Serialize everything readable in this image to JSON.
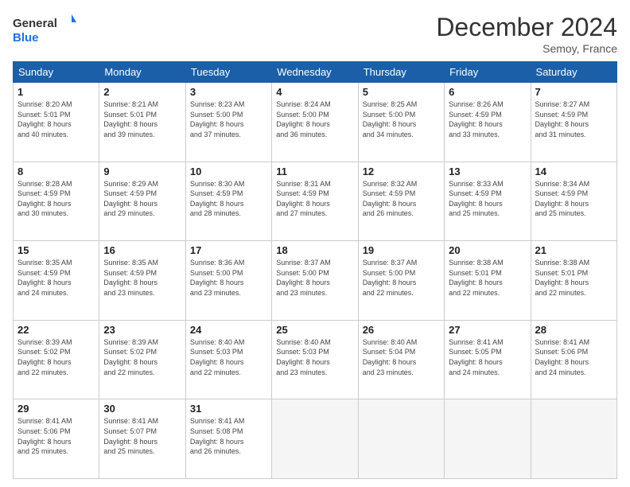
{
  "header": {
    "logo_line1": "General",
    "logo_line2": "Blue",
    "month_title": "December 2024",
    "location": "Semoy, France"
  },
  "days_of_week": [
    "Sunday",
    "Monday",
    "Tuesday",
    "Wednesday",
    "Thursday",
    "Friday",
    "Saturday"
  ],
  "weeks": [
    [
      {
        "day": 1,
        "sunrise": "8:20 AM",
        "sunset": "5:01 PM",
        "daylight": "8 hours and 40 minutes."
      },
      {
        "day": 2,
        "sunrise": "8:21 AM",
        "sunset": "5:01 PM",
        "daylight": "8 hours and 39 minutes."
      },
      {
        "day": 3,
        "sunrise": "8:23 AM",
        "sunset": "5:00 PM",
        "daylight": "8 hours and 37 minutes."
      },
      {
        "day": 4,
        "sunrise": "8:24 AM",
        "sunset": "5:00 PM",
        "daylight": "8 hours and 36 minutes."
      },
      {
        "day": 5,
        "sunrise": "8:25 AM",
        "sunset": "5:00 PM",
        "daylight": "8 hours and 34 minutes."
      },
      {
        "day": 6,
        "sunrise": "8:26 AM",
        "sunset": "4:59 PM",
        "daylight": "8 hours and 33 minutes."
      },
      {
        "day": 7,
        "sunrise": "8:27 AM",
        "sunset": "4:59 PM",
        "daylight": "8 hours and 31 minutes."
      }
    ],
    [
      {
        "day": 8,
        "sunrise": "8:28 AM",
        "sunset": "4:59 PM",
        "daylight": "8 hours and 30 minutes."
      },
      {
        "day": 9,
        "sunrise": "8:29 AM",
        "sunset": "4:59 PM",
        "daylight": "8 hours and 29 minutes."
      },
      {
        "day": 10,
        "sunrise": "8:30 AM",
        "sunset": "4:59 PM",
        "daylight": "8 hours and 28 minutes."
      },
      {
        "day": 11,
        "sunrise": "8:31 AM",
        "sunset": "4:59 PM",
        "daylight": "8 hours and 27 minutes."
      },
      {
        "day": 12,
        "sunrise": "8:32 AM",
        "sunset": "4:59 PM",
        "daylight": "8 hours and 26 minutes."
      },
      {
        "day": 13,
        "sunrise": "8:33 AM",
        "sunset": "4:59 PM",
        "daylight": "8 hours and 25 minutes."
      },
      {
        "day": 14,
        "sunrise": "8:34 AM",
        "sunset": "4:59 PM",
        "daylight": "8 hours and 25 minutes."
      }
    ],
    [
      {
        "day": 15,
        "sunrise": "8:35 AM",
        "sunset": "4:59 PM",
        "daylight": "8 hours and 24 minutes."
      },
      {
        "day": 16,
        "sunrise": "8:35 AM",
        "sunset": "4:59 PM",
        "daylight": "8 hours and 23 minutes."
      },
      {
        "day": 17,
        "sunrise": "8:36 AM",
        "sunset": "5:00 PM",
        "daylight": "8 hours and 23 minutes."
      },
      {
        "day": 18,
        "sunrise": "8:37 AM",
        "sunset": "5:00 PM",
        "daylight": "8 hours and 23 minutes."
      },
      {
        "day": 19,
        "sunrise": "8:37 AM",
        "sunset": "5:00 PM",
        "daylight": "8 hours and 22 minutes."
      },
      {
        "day": 20,
        "sunrise": "8:38 AM",
        "sunset": "5:01 PM",
        "daylight": "8 hours and 22 minutes."
      },
      {
        "day": 21,
        "sunrise": "8:38 AM",
        "sunset": "5:01 PM",
        "daylight": "8 hours and 22 minutes."
      }
    ],
    [
      {
        "day": 22,
        "sunrise": "8:39 AM",
        "sunset": "5:02 PM",
        "daylight": "8 hours and 22 minutes."
      },
      {
        "day": 23,
        "sunrise": "8:39 AM",
        "sunset": "5:02 PM",
        "daylight": "8 hours and 22 minutes."
      },
      {
        "day": 24,
        "sunrise": "8:40 AM",
        "sunset": "5:03 PM",
        "daylight": "8 hours and 22 minutes."
      },
      {
        "day": 25,
        "sunrise": "8:40 AM",
        "sunset": "5:03 PM",
        "daylight": "8 hours and 23 minutes."
      },
      {
        "day": 26,
        "sunrise": "8:40 AM",
        "sunset": "5:04 PM",
        "daylight": "8 hours and 23 minutes."
      },
      {
        "day": 27,
        "sunrise": "8:41 AM",
        "sunset": "5:05 PM",
        "daylight": "8 hours and 24 minutes."
      },
      {
        "day": 28,
        "sunrise": "8:41 AM",
        "sunset": "5:06 PM",
        "daylight": "8 hours and 24 minutes."
      }
    ],
    [
      {
        "day": 29,
        "sunrise": "8:41 AM",
        "sunset": "5:06 PM",
        "daylight": "8 hours and 25 minutes."
      },
      {
        "day": 30,
        "sunrise": "8:41 AM",
        "sunset": "5:07 PM",
        "daylight": "8 hours and 25 minutes."
      },
      {
        "day": 31,
        "sunrise": "8:41 AM",
        "sunset": "5:08 PM",
        "daylight": "8 hours and 26 minutes."
      },
      null,
      null,
      null,
      null
    ]
  ]
}
